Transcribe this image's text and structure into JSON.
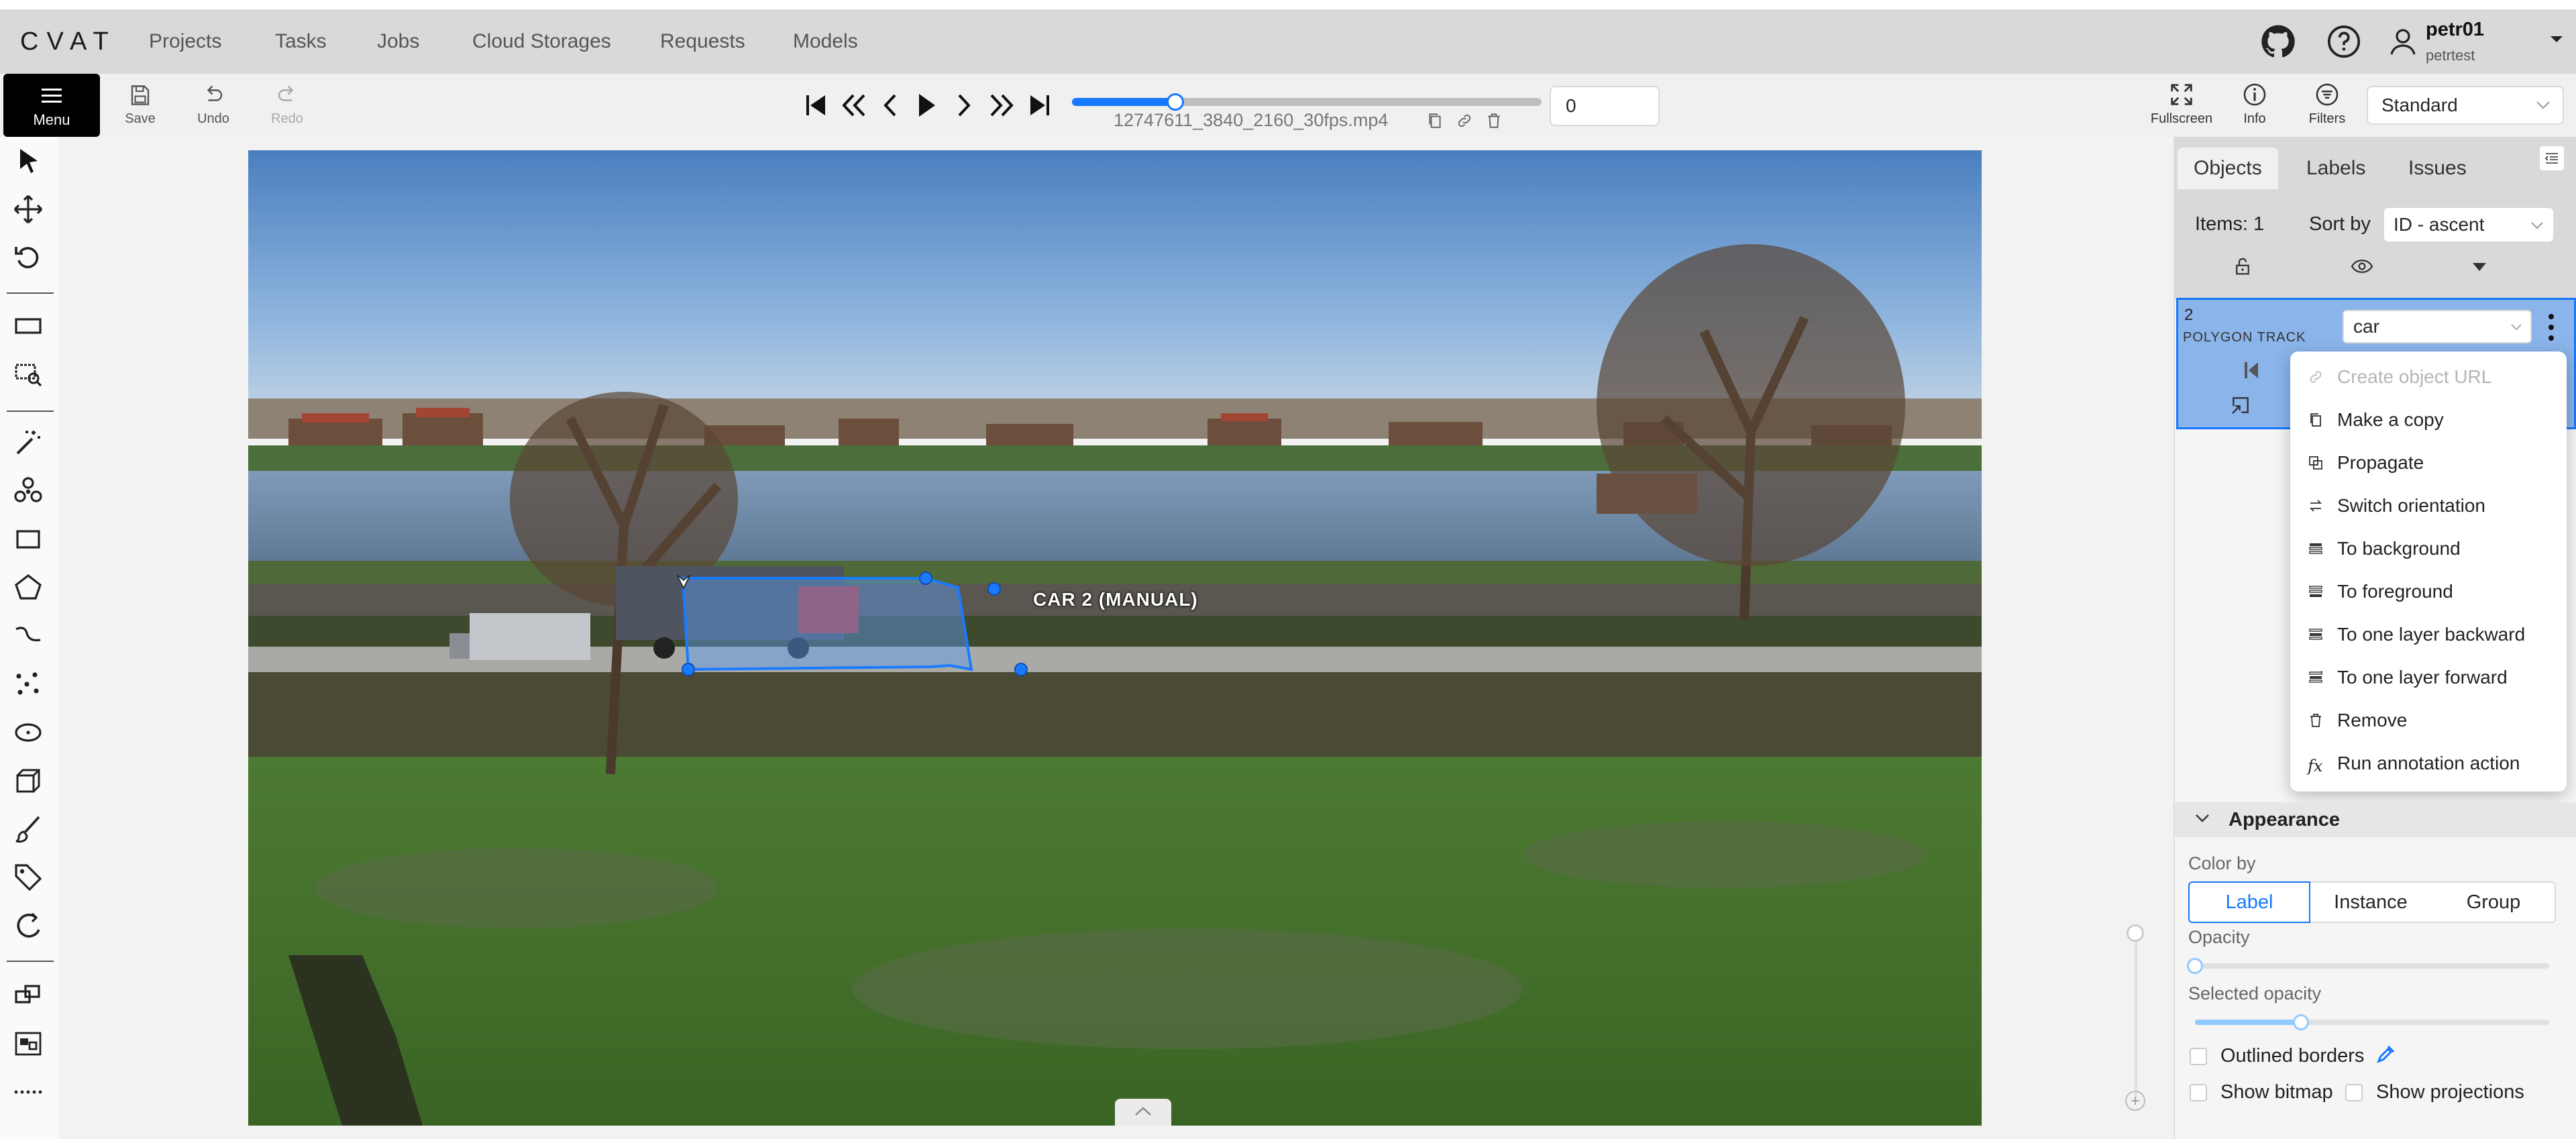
{
  "app": {
    "logo": "CVAT"
  },
  "nav": {
    "items": [
      "Projects",
      "Tasks",
      "Jobs",
      "Cloud Storages",
      "Requests",
      "Models"
    ]
  },
  "user": {
    "name": "petr01",
    "username": "petrtest"
  },
  "toolbar": {
    "menu_label": "Menu",
    "save_label": "Save",
    "undo_label": "Undo",
    "redo_label": "Redo",
    "frame_number": "0",
    "filename": "12747611_3840_2160_30fps.mp4",
    "playback_progress": 0.22,
    "fullscreen_label": "Fullscreen",
    "info_label": "Info",
    "filters_label": "Filters",
    "workspace": "Standard"
  },
  "canvas": {
    "object_label": "CAR 2 (MANUAL)"
  },
  "sidebar": {
    "tabs": [
      "Objects",
      "Labels",
      "Issues"
    ],
    "active_tab": "Objects",
    "items_count": "Items: 1",
    "sort_by_label": "Sort by",
    "sort_by_value": "ID - ascent",
    "object": {
      "id": "2",
      "type": "POLYGON TRACK",
      "label": "car"
    },
    "context_menu": [
      {
        "label": "Create object URL",
        "icon": "link-icon",
        "disabled": true
      },
      {
        "label": "Make a copy",
        "icon": "copy-icon",
        "disabled": false
      },
      {
        "label": "Propagate",
        "icon": "propagate-icon",
        "disabled": false
      },
      {
        "label": "Switch orientation",
        "icon": "swap-icon",
        "disabled": false
      },
      {
        "label": "To background",
        "icon": "layer-bottom-icon",
        "disabled": false
      },
      {
        "label": "To foreground",
        "icon": "layer-top-icon",
        "disabled": false
      },
      {
        "label": "To one layer backward",
        "icon": "layer-down-icon",
        "disabled": false
      },
      {
        "label": "To one layer forward",
        "icon": "layer-up-icon",
        "disabled": false
      },
      {
        "label": "Remove",
        "icon": "trash-icon",
        "disabled": false
      },
      {
        "label": "Run annotation action",
        "icon": "function-icon",
        "disabled": false
      }
    ],
    "appearance": {
      "title": "Appearance",
      "color_by_label": "Color by",
      "color_by_options": [
        "Label",
        "Instance",
        "Group"
      ],
      "color_by_selected": "Label",
      "opacity_label": "Opacity",
      "opacity_value": 0.0,
      "selected_opacity_label": "Selected opacity",
      "selected_opacity_value": 0.3,
      "outlined_borders_label": "Outlined borders",
      "show_bitmap_label": "Show bitmap",
      "show_projections_label": "Show projections"
    }
  },
  "colors": {
    "accent": "#1677ff",
    "polygon_fill": "#8ab4ea",
    "header_bg": "#d9d9d9"
  }
}
